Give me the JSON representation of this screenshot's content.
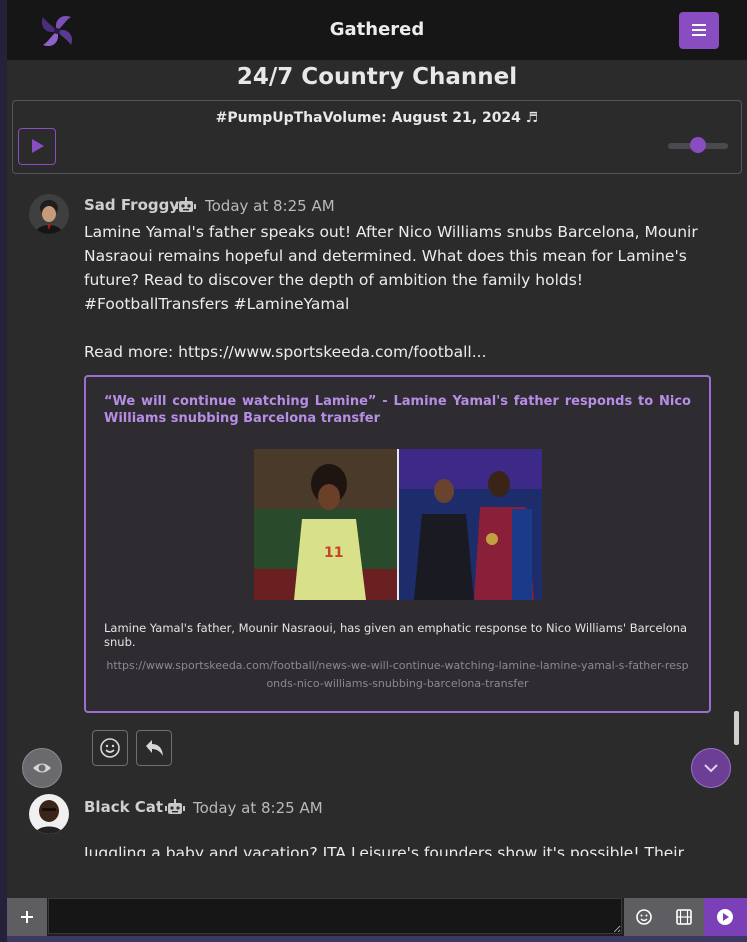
{
  "header": {
    "app_title": "Gathered",
    "logo_icon": "pinwheel-logo-icon",
    "menu_icon": "hamburger-menu-icon"
  },
  "channel": {
    "title": "24/7 Country Channel"
  },
  "player": {
    "now_playing": "#PumpUpThaVolume: August 21, 2024 ♬",
    "play_icon": "play-icon",
    "volume_level": 0.5
  },
  "messages": [
    {
      "username": "Sad Froggy",
      "bot_icon": "robot-icon",
      "timestamp": "Today at 8:25 AM",
      "text": "Lamine Yamal's father speaks out! After Nico Williams snubs Barcelona, Mounir Nasraoui remains hopeful and determined. What does this mean for Lamine's future? Read to discover the depth of ambition the family holds! #FootballTransfers #LamineYamal\n\nRead more: https://www.sportskeeda.com/football...",
      "embed": {
        "title": "“We will continue watching Lamine” - Lamine Yamal's father responds to Nico Williams snubbing Barcelona transfer",
        "description": "Lamine Yamal's father, Mounir Nasraoui, has given an emphatic response to Nico Williams' Barcelona snub.",
        "url": "https://www.sportskeeda.com/football/news-we-will-continue-watching-lamine-lamine-yamal-s-father-responds-nico-williams-snubbing-barcelona-transfer"
      },
      "actions": [
        "smiley-icon",
        "reply-icon"
      ]
    },
    {
      "username": "Black Cat",
      "bot_icon": "robot-icon",
      "timestamp": "Today at 8:25 AM",
      "text": "Juggling a baby and vacation? ITA Leisure's founders show it's possible! Their"
    }
  ],
  "composer": {
    "placeholder": "",
    "tools": [
      "plus-icon",
      "emoji-icon",
      "film-icon",
      "send-icon"
    ]
  },
  "colors": {
    "accent": "#8a4cc1",
    "embed_title": "#b68ee6",
    "background": "#2b2b2c",
    "header": "#161616"
  }
}
